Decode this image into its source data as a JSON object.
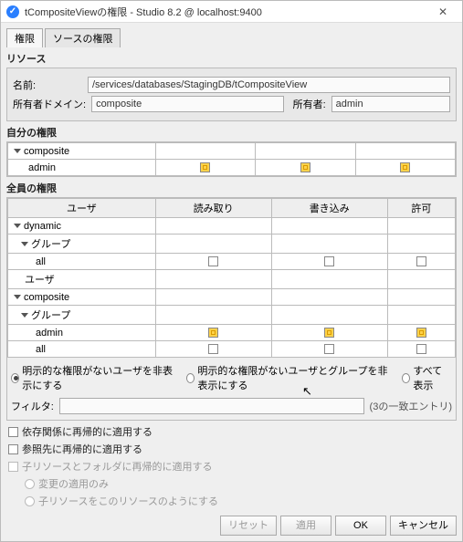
{
  "titlebar": {
    "title": "tCompositeViewの権限 - Studio 8.2 @ localhost:9400"
  },
  "tabs": {
    "t0": "権限",
    "t1": "ソースの権限"
  },
  "resource": {
    "section": "リソース",
    "name_label": "名前:",
    "name_value": "/services/databases/StagingDB/tCompositeView",
    "owner_domain_label": "所有者ドメイン:",
    "owner_domain_value": "composite",
    "owner_label": "所有者:",
    "owner_value": "admin"
  },
  "self_perm": {
    "section": "自分の権限",
    "rows": [
      {
        "name": "composite",
        "kind": "domain"
      },
      {
        "name": "admin",
        "kind": "user"
      }
    ]
  },
  "all_perm": {
    "section": "全員の権限",
    "headers": {
      "user": "ユーザ",
      "read": "読み取り",
      "write": "書き込み",
      "grant": "許可"
    },
    "rows": [
      {
        "name": "dynamic",
        "kind": "domain"
      },
      {
        "name": "グループ",
        "kind": "group"
      },
      {
        "name": "all",
        "kind": "user",
        "read": "empty",
        "write": "empty",
        "grant": "empty"
      },
      {
        "name": "ユーザ",
        "kind": "label"
      },
      {
        "name": "composite",
        "kind": "domain"
      },
      {
        "name": "グループ",
        "kind": "group"
      },
      {
        "name": "admin",
        "kind": "user",
        "read": "yellow",
        "write": "yellow",
        "grant": "yellow"
      },
      {
        "name": "all",
        "kind": "user",
        "read": "empty",
        "write": "empty",
        "grant": "empty"
      }
    ],
    "radios": {
      "r0": "明示的な権限がないユーザを非表示にする",
      "r1": "明示的な権限がないユーザとグループを非表示にする",
      "r2": "すべて表示",
      "selected": 0
    },
    "filter_label": "フィルタ:",
    "filter_meta": "(3の一致エントリ)"
  },
  "options": {
    "o0": "依存関係に再帰的に適用する",
    "o1": "参照先に再帰的に適用する",
    "o2": "子リソースとフォルダに再帰的に適用する",
    "o3": "変更の適用のみ",
    "o4": "子リソースをこのリソースのようにする"
  },
  "buttons": {
    "reset": "リセット",
    "apply": "適用",
    "ok": "OK",
    "cancel": "キャンセル"
  }
}
